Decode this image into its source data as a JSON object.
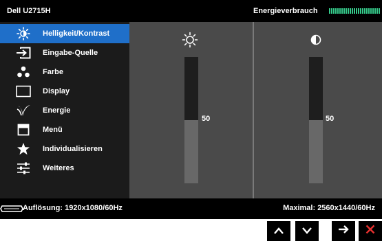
{
  "header": {
    "title": "Dell U2715H",
    "energy_label": "Energieverbrauch",
    "energy_meter_icon": "energy-meter-icon",
    "meter_color": "#35c98a"
  },
  "sidebar": {
    "items": [
      {
        "label": "Helligkeit/Kontrast",
        "icon": "brightness-icon",
        "selected": true
      },
      {
        "label": "Eingabe-Quelle",
        "icon": "input-source-icon",
        "selected": false
      },
      {
        "label": "Farbe",
        "icon": "color-icon",
        "selected": false
      },
      {
        "label": "Display",
        "icon": "display-icon",
        "selected": false
      },
      {
        "label": "Energie",
        "icon": "energy-leaf-icon",
        "selected": false
      },
      {
        "label": "Menü",
        "icon": "menu-icon",
        "selected": false
      },
      {
        "label": "Individualisieren",
        "icon": "star-icon",
        "selected": false
      },
      {
        "label": "Weiteres",
        "icon": "sliders-icon",
        "selected": false
      }
    ],
    "selected_color": "#1f6fc9"
  },
  "panels": {
    "brightness": {
      "icon": "sun-icon",
      "value": "50"
    },
    "contrast": {
      "icon": "contrast-icon",
      "value": "50"
    }
  },
  "footer": {
    "cable_icon": "cable-icon",
    "resolution": "Auflösung: 1920x1080/60Hz",
    "maximal": "Maximal: 2560x1440/60Hz"
  },
  "nav_buttons": [
    {
      "icon": "arrow-up-icon"
    },
    {
      "icon": "arrow-down-icon"
    },
    {
      "icon": "arrow-right-icon"
    },
    {
      "icon": "close-icon",
      "color": "#e8312f"
    }
  ]
}
